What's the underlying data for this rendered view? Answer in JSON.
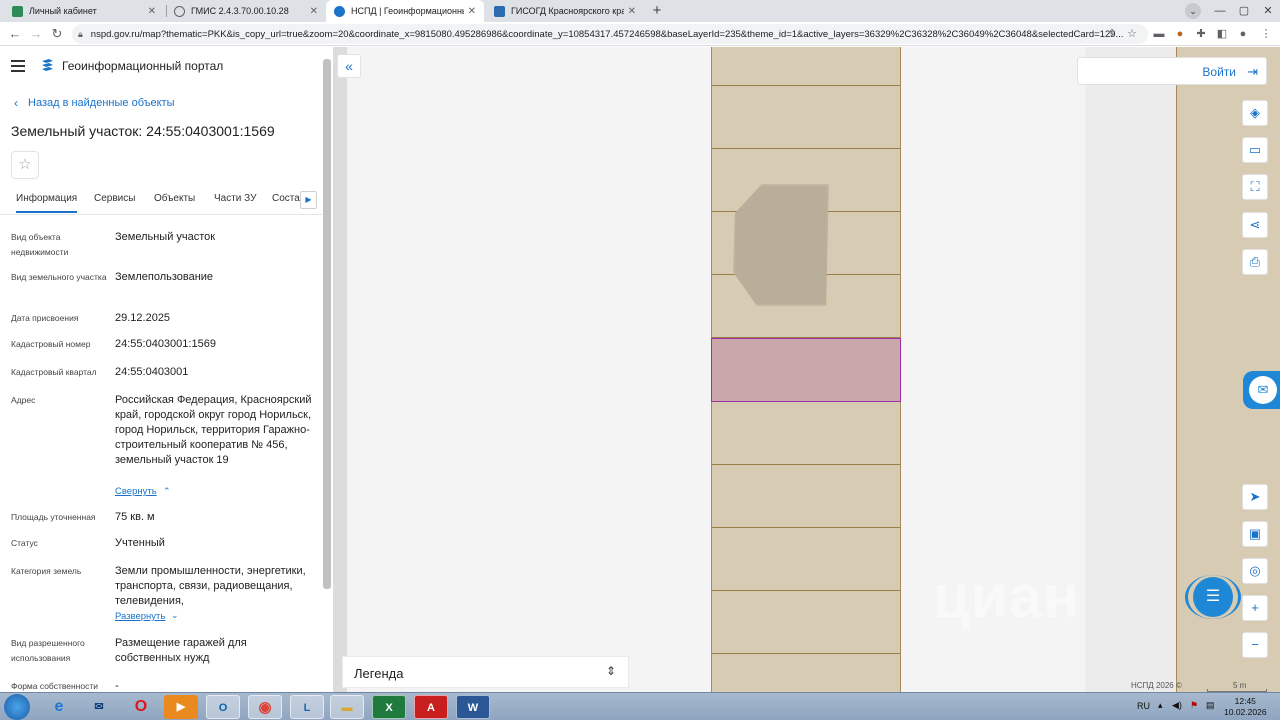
{
  "browser": {
    "tabs": [
      {
        "title": "Личный кабинет",
        "active": false
      },
      {
        "title": "ГМИС 2.4.3.70.00.10.28",
        "active": false
      },
      {
        "title": "НСПД | Геоинформационный п...",
        "active": true
      },
      {
        "title": "ГИСОГД Красноярского края",
        "active": false
      }
    ],
    "url": "nspd.gov.ru/map?thematic=PKK&is_copy_url=true&zoom=20&coordinate_x=9815080.495286986&coordinate_y=10854317.457246598&baseLayerId=235&theme_id=1&active_layers=36329%2C36328%2C36049%2C36048&selectedCard=129..."
  },
  "portal": {
    "title": "Геоинформационный портал",
    "back_link": "Назад в найденные объекты",
    "object_title": "Земельный участок: 24:55:0403001:1569"
  },
  "panel_tabs": [
    "Информация",
    "Сервисы",
    "Объекты",
    "Части ЗУ"
  ],
  "panel_tab_clipped": "Состав",
  "properties": [
    {
      "label": "Вид объекта недвижимости",
      "value": "Земельный участок"
    },
    {
      "label": "Вид земельного участка",
      "value": "Землепользование"
    },
    {
      "label": "Дата присвоения",
      "value": "29.12.2025"
    },
    {
      "label": "Кадастровый номер",
      "value": "24:55:0403001:1569"
    },
    {
      "label": "Кадастровый квартал",
      "value": "24:55:0403001"
    },
    {
      "label": "Адрес",
      "value": "Российская Федерация, Красноярский край, городской округ город Норильск, город Норильск, территория Гаражно-строительный кооператив № 456, земельный участок 19"
    },
    {
      "label": "Площадь уточненная",
      "value": "75 кв. м"
    },
    {
      "label": "Статус",
      "value": "Учтенный"
    },
    {
      "label": "Категория земель",
      "value": "Земли промышленности, энергетики, транспорта, связи, радиовещания, телевидения,"
    },
    {
      "label": "Вид разрешенного использования",
      "value": "Размещение гаражей для собственных нужд"
    },
    {
      "label": "Форма собственности",
      "value": "-"
    }
  ],
  "toggles": {
    "collapse": "Свернуть",
    "expand": "Развернуть"
  },
  "map": {
    "login": "Войти",
    "legend": "Легенда",
    "attribution": "НСПД 2026 ©",
    "scale": "5 m",
    "watermark": "циан"
  },
  "taskbar": {
    "lang": "RU",
    "time": "12:45",
    "date": "10.02.2026"
  },
  "colors": {
    "accent": "#1a73c9",
    "parcel_fill": "#d8cbb3",
    "parcel_border": "#9c7f46",
    "selected_fill": "#c9a7ab",
    "selected_border": "#a12fa8"
  }
}
